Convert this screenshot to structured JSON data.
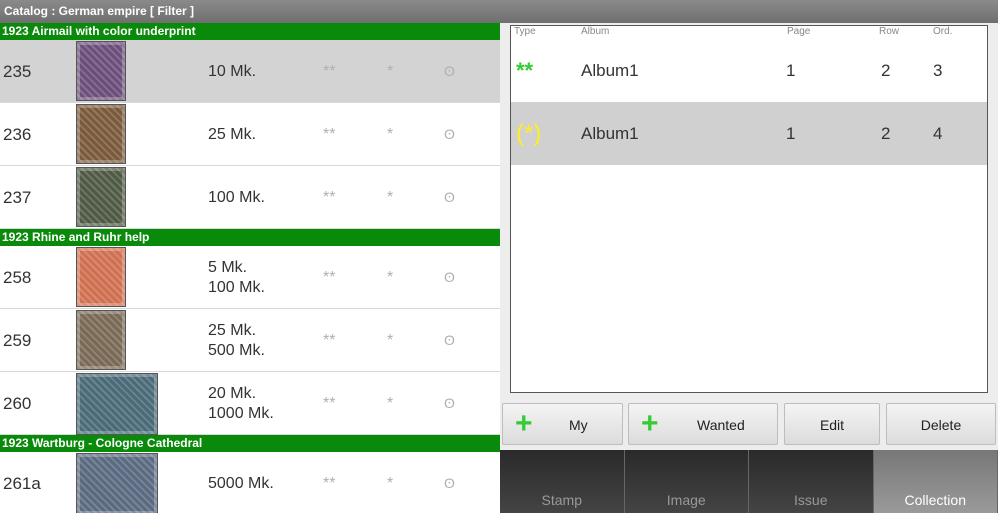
{
  "window": {
    "title": "Catalog : German empire [ Filter ]"
  },
  "sections": [
    {
      "header": "1923 Airmail with color underprint",
      "rows": [
        {
          "number": "235",
          "values": [
            "10 Mk."
          ],
          "marks": [
            "**",
            "*",
            "ʘ"
          ],
          "selected": true,
          "stamp_color": "#6b4f7a"
        },
        {
          "number": "236",
          "values": [
            "25 Mk."
          ],
          "marks": [
            "**",
            "*",
            "ʘ"
          ],
          "selected": false,
          "stamp_color": "#7a5a3b"
        },
        {
          "number": "237",
          "values": [
            "100 Mk."
          ],
          "marks": [
            "**",
            "*",
            "ʘ"
          ],
          "selected": false,
          "stamp_color": "#4f5a45"
        }
      ]
    },
    {
      "header": "1923 Rhine and Ruhr help",
      "rows": [
        {
          "number": "258",
          "values": [
            "5 Mk.",
            "100 Mk."
          ],
          "marks": [
            "**",
            "*",
            "ʘ"
          ],
          "selected": false,
          "stamp_color": "#d07050"
        },
        {
          "number": "259",
          "values": [
            "25 Mk.",
            "500 Mk."
          ],
          "marks": [
            "**",
            "*",
            "ʘ"
          ],
          "selected": false,
          "stamp_color": "#7a6a55"
        },
        {
          "number": "260",
          "values": [
            "20 Mk.",
            "1000 Mk."
          ],
          "marks": [
            "**",
            "*",
            "ʘ"
          ],
          "selected": false,
          "stamp_color": "#4a6a78"
        }
      ]
    },
    {
      "header": "1923 Wartburg - Cologne Cathedral",
      "rows": [
        {
          "number": "261a",
          "values": [
            "5000 Mk."
          ],
          "marks": [
            "**",
            "*",
            "ʘ"
          ],
          "selected": false,
          "stamp_color": "#5a6a80"
        }
      ]
    }
  ],
  "collection": {
    "columns": {
      "type": "Type",
      "album": "Album",
      "page": "Page",
      "row": "Row",
      "ord": "Ord."
    },
    "items": [
      {
        "type": "**",
        "type_color": "#33cc33",
        "album": "Album1",
        "page": "1",
        "row": "2",
        "ord": "3",
        "selected": false
      },
      {
        "type": "(*)",
        "type_color": "#ffee22",
        "album": "Album1",
        "page": "1",
        "row": "2",
        "ord": "4",
        "selected": true
      }
    ]
  },
  "buttons": {
    "my": "My",
    "wanted": "Wanted",
    "edit": "Edit",
    "delete": "Delete",
    "plus": "+"
  },
  "tabs": [
    {
      "label": "Stamp",
      "active": false
    },
    {
      "label": "Image",
      "active": false
    },
    {
      "label": "Issue",
      "active": false
    },
    {
      "label": "Collection",
      "active": true
    }
  ]
}
